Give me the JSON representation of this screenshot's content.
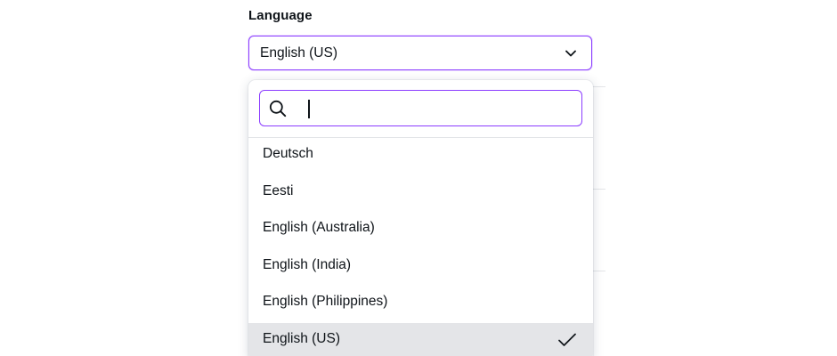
{
  "language_field": {
    "label": "Language",
    "selected_value": "English (US)",
    "accent_color": "#8b3dff",
    "icon": "chevron-down-icon"
  },
  "dropdown": {
    "search": {
      "placeholder": "",
      "value": "",
      "icon": "search-icon"
    },
    "options": [
      {
        "label": "Deutsch",
        "selected": false
      },
      {
        "label": "Eesti",
        "selected": false
      },
      {
        "label": "English (Australia)",
        "selected": false
      },
      {
        "label": "English (India)",
        "selected": false
      },
      {
        "label": "English (Philippines)",
        "selected": false
      },
      {
        "label": "English (US)",
        "selected": true
      }
    ],
    "selected_icon": "check-icon",
    "selected_bg": "#e4e5e8"
  }
}
